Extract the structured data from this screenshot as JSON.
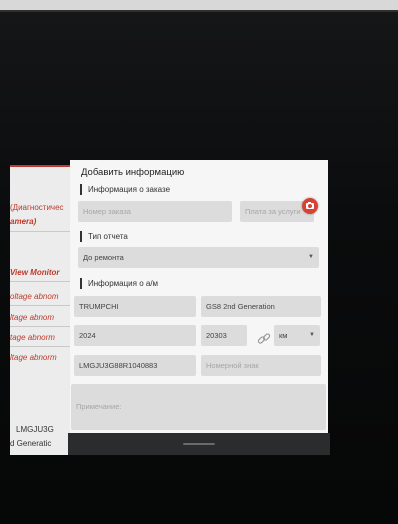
{
  "left_panel": {
    "items": [
      {
        "label": "(Диагностичес"
      },
      {
        "label": "amera)"
      },
      {
        "label": "View Monitor"
      },
      {
        "label": "oltage abnom"
      },
      {
        "label": "ltage abnom"
      },
      {
        "label": "tage abnorm"
      },
      {
        "label": "ltage abnorm"
      },
      {
        "label": "LMGJU3G"
      },
      {
        "label": "d Generatic"
      }
    ]
  },
  "dialog": {
    "title": "Добавить информацию",
    "order_section": {
      "label": "Информация о заказе",
      "order_number_placeholder": "Номер заказа",
      "service_fee_placeholder": "Плата за услуги"
    },
    "report_section": {
      "label": "Тип отчета",
      "report_type_value": "До ремонта"
    },
    "vehicle_section": {
      "label": "Информация о а/м",
      "make": "TRUMPCHI",
      "model": "GS8 2nd Generation",
      "year": "2024",
      "mileage": "20303",
      "unit": "км",
      "vin": "LMGJU3G88R1040883",
      "plate_placeholder": "Номерной знак",
      "notes_placeholder": "Примечание:"
    }
  },
  "icons": {
    "camera": "camera-icon",
    "link": "link-icon",
    "dropdown": "chevron-down-icon"
  },
  "colors": {
    "accent": "#d84235",
    "field_bg": "#dcdcdc",
    "dialog_bg": "#f6f6f6",
    "left_text": "#c0392b"
  }
}
